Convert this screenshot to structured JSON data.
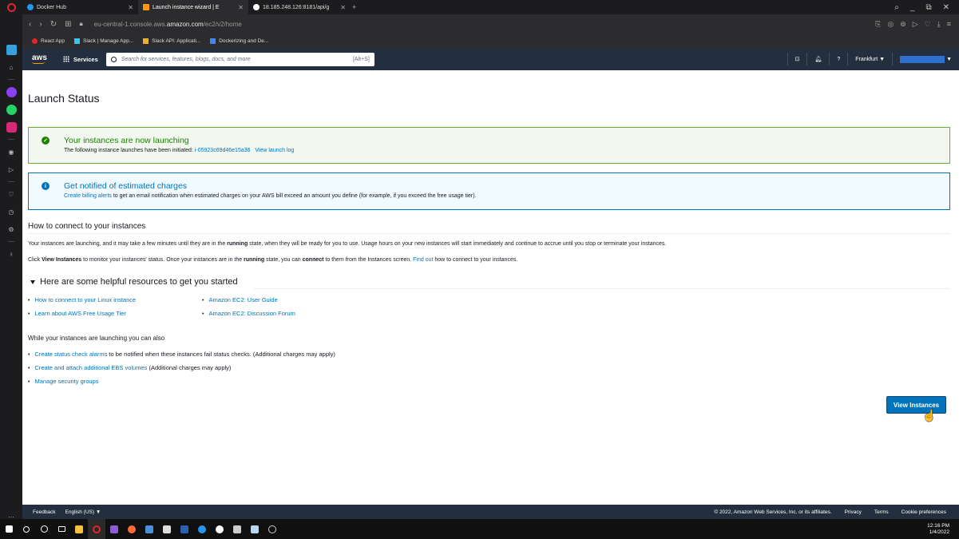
{
  "browser": {
    "tabs": [
      {
        "title": "Docker Hub",
        "active": false
      },
      {
        "title": "Launch instance wizard | E",
        "active": true
      },
      {
        "title": "18.185.248.126:8181/api/g",
        "active": false
      }
    ],
    "url_prefix": "eu-central-1.console.aws.",
    "url_domain": "amazon.com",
    "url_path": "/ec2/v2/home",
    "bookmarks": [
      "React App",
      "Slack | Manage App...",
      "Slack API: Applicati...",
      "Dockerizing and De..."
    ]
  },
  "aws_nav": {
    "logo": "aws",
    "services_label": "Services",
    "search_placeholder": "Search for services, features, blogs, docs, and more",
    "search_shortcut": "[Alt+S]",
    "region": "Frankfurt ▼",
    "account_caret": "▼"
  },
  "page": {
    "title": "Launch Status",
    "success_alert": {
      "title": "Your instances are now launching",
      "body_prefix": "The following instance launches have been initiated:",
      "instance_id": "i-05923c69d46e15a36",
      "view_log": "View launch log"
    },
    "info_alert": {
      "title": "Get notified of estimated charges",
      "link": "Create billing alerts",
      "body": " to get an email notification when estimated charges on your AWS bill exceed an amount you define (for example, if you exceed the free usage tier)."
    },
    "connect_heading": "How to connect to your instances",
    "para1_a": "Your instances are launching, and it may take a few minutes until they are in the ",
    "para1_b": "running",
    "para1_c": " state, when they will be ready for you to use. Usage hours on your new instances will start immediately and continue to accrue until you stop or terminate your instances.",
    "para2_a": "Click ",
    "para2_b": "View Instances",
    "para2_c": " to monitor your instances' status. Once your instances are in the ",
    "para2_d": "running",
    "para2_e": " state, you can ",
    "para2_f": "connect",
    "para2_g": " to them from the Instances screen. ",
    "para2_link": "Find out",
    "para2_h": " how to connect to your instances.",
    "resources_heading": "Here are some helpful resources to get you started",
    "resources_left": [
      "How to connect to your Linux instance",
      "Learn about AWS Free Usage Tier"
    ],
    "resources_right": [
      "Amazon EC2: User Guide",
      "Amazon EC2: Discussion Forum"
    ],
    "also_heading": "While your instances are launching you can also",
    "also_items": [
      {
        "link": "Create status check alarms",
        "text": " to be notified when these instances fail status checks. (Additional charges may apply)"
      },
      {
        "link": "Create and attach additional EBS volumes",
        "text": " (Additional charges may apply)"
      },
      {
        "link": "Manage security groups",
        "text": ""
      }
    ],
    "view_instances_button": "View Instances"
  },
  "footer": {
    "feedback": "Feedback",
    "language": "English (US) ▼",
    "copyright": "© 2022, Amazon Web Services, Inc. or its affiliates.",
    "privacy": "Privacy",
    "terms": "Terms",
    "cookies": "Cookie preferences"
  },
  "taskbar": {
    "time": "12:16 PM",
    "date": "1/4/2022"
  },
  "colors": {
    "aws_nav": "#232f3e",
    "aws_orange": "#ff9900",
    "link_blue": "#0073bb",
    "success_green": "#1d8102",
    "primary_button": "#0073bb"
  }
}
